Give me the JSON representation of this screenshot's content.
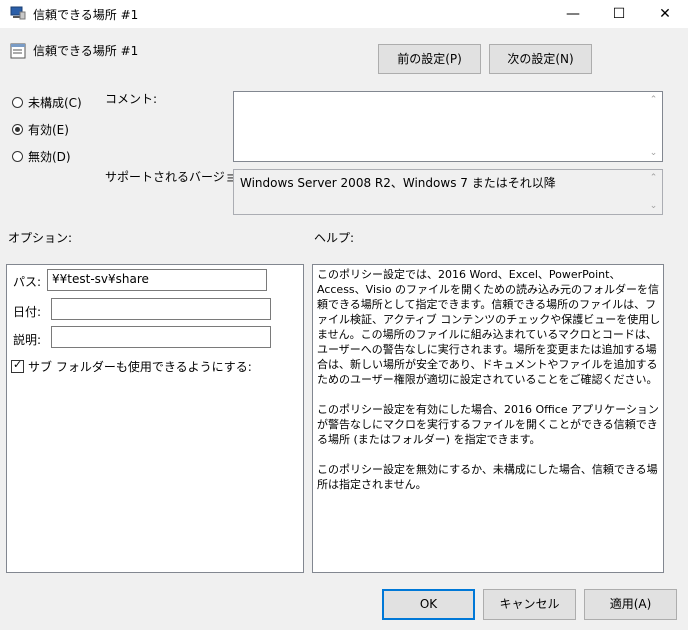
{
  "window": {
    "title": "信頼できる場所 #1",
    "minimize": "—",
    "maximize": "☐",
    "close": "✕"
  },
  "header": {
    "title": "信頼できる場所 #1",
    "prev_button": "前の設定(P)",
    "next_button": "次の設定(N)"
  },
  "state": {
    "not_configured": "未構成(C)",
    "enabled": "有効(E)",
    "disabled": "無効(D)",
    "selected": "enabled"
  },
  "comment": {
    "label": "コメント:",
    "value": ""
  },
  "supported": {
    "label": "サポートされるバージョン:",
    "value": "Windows Server 2008 R2、Windows 7 またはそれ以降"
  },
  "options": {
    "label": "オプション:",
    "path_label": "パス:",
    "path_value": "¥¥test-sv¥share",
    "date_label": "日付:",
    "date_value": "",
    "desc_label": "説明:",
    "desc_value": "",
    "subfolders_label": "サブ フォルダーも使用できるようにする:",
    "subfolders_checked": true
  },
  "help": {
    "label": "ヘルプ:",
    "para1": "このポリシー設定では、2016 Word、Excel、PowerPoint、Access、Visio のファイルを開くための読み込み元のフォルダーを信頼できる場所として指定できます。信頼できる場所のファイルは、ファイル検証、アクティブ コンテンツのチェックや保護ビューを使用しません。この場所のファイルに組み込まれているマクロとコードは、ユーザーへの警告なしに実行されます。場所を変更または追加する場合は、新しい場所が安全であり、ドキュメントやファイルを追加するためのユーザー権限が適切に設定されていることをご確認ください。",
    "para2": "このポリシー設定を有効にした場合、2016 Office アプリケーションが警告なしにマクロを実行するファイルを開くことができる信頼できる場所 (またはフォルダー) を指定できます。",
    "para3": "このポリシー設定を無効にするか、未構成にした場合、信頼できる場所は指定されません。"
  },
  "footer": {
    "ok": "OK",
    "cancel": "キャンセル",
    "apply": "適用(A)"
  }
}
